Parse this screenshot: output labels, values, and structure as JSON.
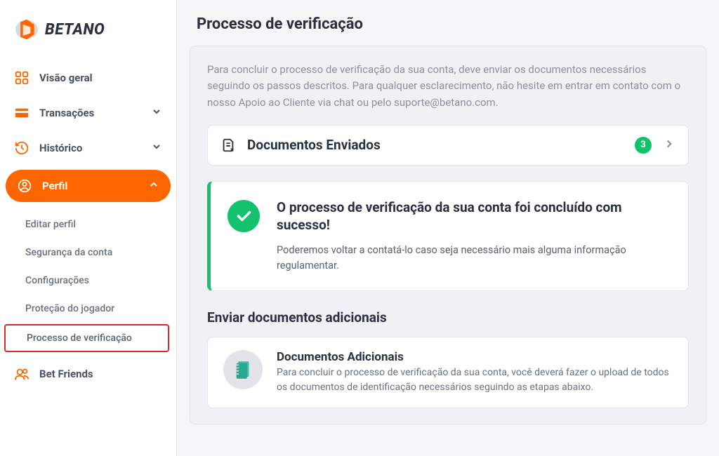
{
  "brand": {
    "name": "BETANO"
  },
  "sidebar": {
    "items": [
      {
        "label": "Visão geral"
      },
      {
        "label": "Transações"
      },
      {
        "label": "Histórico"
      },
      {
        "label": "Perfil"
      },
      {
        "label": "Bet Friends"
      }
    ],
    "profile_sub": [
      {
        "label": "Editar perfil"
      },
      {
        "label": "Segurança da conta"
      },
      {
        "label": "Configurações"
      },
      {
        "label": "Proteção do jogador"
      },
      {
        "label": "Processo de verificação"
      }
    ]
  },
  "page": {
    "title": "Processo de verificação",
    "intro": "Para concluir o processo de verificação da sua conta, deve enviar os documentos necessários seguindo os passos descritos. Para qualquer esclarecimento, não hesite em entrar em contato com o nosso Apoio ao Cliente via chat ou pelo suporte@betano.com.",
    "docs_sent": {
      "label": "Documentos Enviados",
      "count": "3"
    },
    "success": {
      "title": "O processo de verificação da sua conta foi concluído com sucesso!",
      "sub": "Poderemos voltar a contatá-lo caso seja necessário mais alguma informação regulamentar."
    },
    "additional_section_title": "Enviar documentos adicionais",
    "additional": {
      "title": "Documentos Adicionais",
      "text": "Para concluir o processo de verificação da sua conta, você deverá fazer o upload de todos os documentos de identificação necessários seguindo as etapas abaixo."
    }
  },
  "colors": {
    "accent": "#FF6600",
    "success": "#14c26d"
  }
}
